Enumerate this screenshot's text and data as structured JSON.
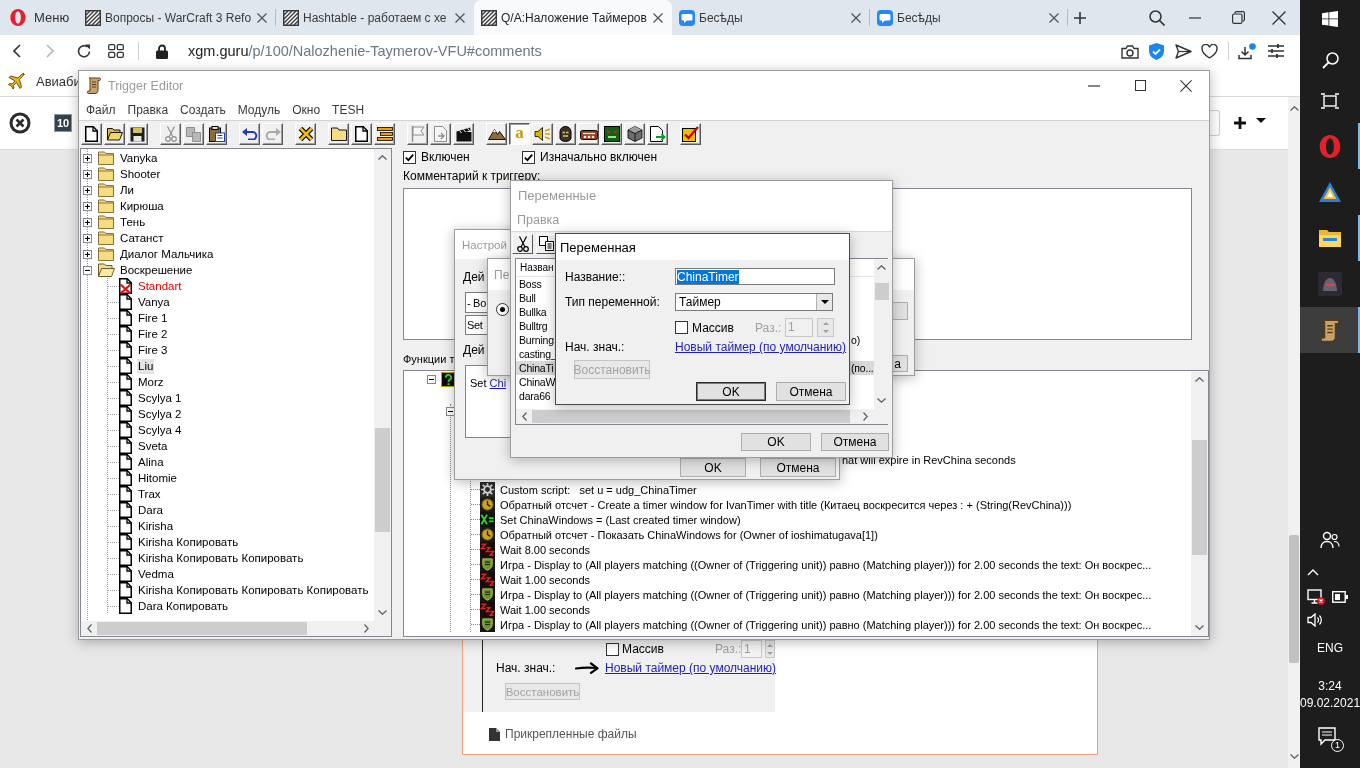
{
  "browser": {
    "menu": {
      "label": "Меню"
    },
    "tabs": [
      {
        "kind": "site",
        "title": "Вопросы - WarCraft 3 Refo",
        "selected": false
      },
      {
        "kind": "site",
        "title": "Hashtable - работаем с хе",
        "selected": false
      },
      {
        "kind": "site",
        "title": "Q/A:Наложение Таймеров",
        "selected": true
      },
      {
        "kind": "chat",
        "title": "Бесѣды",
        "selected": false
      },
      {
        "kind": "chat",
        "title": "Бесѣды",
        "selected": false
      }
    ],
    "nav": [
      {
        "kind": "back",
        "disabled": false
      },
      {
        "kind": "forward",
        "disabled": true
      },
      {
        "kind": "reload",
        "disabled": false
      }
    ],
    "address": {
      "host": "xgm.guru",
      "path": "/p/100/Nalozhenie-Taymerov-VFU#comments"
    },
    "bookmarks": [
      {
        "label": "Авиаби"
      }
    ]
  },
  "page": {
    "badge": "10",
    "preview": {
      "array": {
        "label": "Массив",
        "checked": false
      },
      "size": {
        "label": "Раз.:",
        "value": "1",
        "disabled": true
      },
      "initial_label": "Нач. знач.:",
      "initial_link": "Новый таймер (по умолчанию)",
      "restore": {
        "label": "Восстановить",
        "disabled": true
      }
    },
    "attachments_label": "Прикрепленные файлы"
  },
  "trigger_editor": {
    "title": "Trigger Editor",
    "menu": [
      "Файл",
      "Правка",
      "Создать",
      "Модуль",
      "Окно",
      "TESH"
    ],
    "toolbar": [
      [
        {
          "kind": "new",
          "disabled": false,
          "pressed": false
        },
        {
          "kind": "open",
          "disabled": false,
          "pressed": false
        },
        {
          "kind": "save",
          "disabled": false,
          "pressed": false
        }
      ],
      [
        {
          "kind": "cut",
          "disabled": true,
          "pressed": false
        },
        {
          "kind": "copy",
          "disabled": true,
          "pressed": false
        },
        {
          "kind": "paste",
          "disabled": false,
          "pressed": false
        }
      ],
      [
        {
          "kind": "undo",
          "disabled": false,
          "pressed": false
        },
        {
          "kind": "redo",
          "disabled": true,
          "pressed": false
        }
      ],
      [
        {
          "kind": "close",
          "disabled": false,
          "pressed": false
        }
      ],
      [
        {
          "kind": "folder",
          "disabled": false,
          "pressed": false
        },
        {
          "kind": "trigger",
          "disabled": false,
          "pressed": false
        },
        {
          "kind": "comment",
          "disabled": false,
          "pressed": false
        }
      ],
      [
        {
          "kind": "flag",
          "disabled": true,
          "pressed": false
        },
        {
          "kind": "doc",
          "disabled": true,
          "pressed": false
        },
        {
          "kind": "clapper",
          "disabled": false,
          "pressed": false
        }
      ],
      [
        {
          "kind": "terrain",
          "disabled": false,
          "pressed": false
        },
        {
          "kind": "text",
          "glyph": "a",
          "disabled": false,
          "pressed": true
        },
        {
          "kind": "sound",
          "disabled": false,
          "pressed": false
        },
        {
          "kind": "mask",
          "disabled": false,
          "pressed": false
        },
        {
          "kind": "object",
          "disabled": false,
          "pressed": false
        },
        {
          "kind": "face",
          "disabled": false,
          "pressed": false
        },
        {
          "kind": "box",
          "disabled": false,
          "pressed": false
        },
        {
          "kind": "import",
          "disabled": false,
          "pressed": false
        }
      ],
      [
        {
          "kind": "validate",
          "disabled": false,
          "pressed": false
        }
      ]
    ],
    "tree": [
      {
        "label": "Vanyka",
        "expanded": false,
        "selected": false
      },
      {
        "label": "Shooter",
        "expanded": false,
        "selected": false
      },
      {
        "label": "Ли",
        "expanded": false,
        "selected": false
      },
      {
        "label": "Кирюша",
        "expanded": false,
        "selected": false
      },
      {
        "label": "Тень",
        "expanded": false,
        "selected": false
      },
      {
        "label": "Сатанст",
        "expanded": false,
        "selected": false
      },
      {
        "label": "Диалог Мальчика",
        "expanded": false,
        "selected": false
      },
      {
        "label": "Воскрешение",
        "expanded": true,
        "selected": false,
        "children": [
          {
            "label": "Standart",
            "enabled": false,
            "selected": false
          },
          {
            "label": "Vanya",
            "enabled": true,
            "selected": false
          },
          {
            "label": "Fire 1",
            "enabled": true,
            "selected": false
          },
          {
            "label": "Fire 2",
            "enabled": true,
            "selected": false
          },
          {
            "label": "Fire 3",
            "enabled": true,
            "selected": false
          },
          {
            "label": "Liu",
            "enabled": true,
            "selected": true
          },
          {
            "label": "Morz",
            "enabled": true,
            "selected": false
          },
          {
            "label": "Scylya 1",
            "enabled": true,
            "selected": false
          },
          {
            "label": "Scylya 2",
            "enabled": true,
            "selected": false
          },
          {
            "label": "Scylya 4",
            "enabled": true,
            "selected": false
          },
          {
            "label": "Sveta",
            "enabled": true,
            "selected": false
          },
          {
            "label": "Alina",
            "enabled": true,
            "selected": false
          },
          {
            "label": "Hitomie",
            "enabled": true,
            "selected": false
          },
          {
            "label": "Trax",
            "enabled": true,
            "selected": false
          },
          {
            "label": "Dara",
            "enabled": true,
            "selected": false
          },
          {
            "label": "Kirisha",
            "enabled": true,
            "selected": false
          },
          {
            "label": "Kirisha Копировать",
            "enabled": true,
            "selected": false
          },
          {
            "label": "Kirisha Копировать Копировать",
            "enabled": true,
            "selected": false
          },
          {
            "label": "Vedma",
            "enabled": true,
            "selected": false
          },
          {
            "label": "Kirisha Копировать Копировать Копировать",
            "enabled": true,
            "selected": false
          },
          {
            "label": "Dara Копировать",
            "enabled": true,
            "selected": false
          }
        ]
      }
    ],
    "enabled": {
      "label": "Включен",
      "checked": true
    },
    "initially_on": {
      "label": "Изначально включен",
      "checked": true
    },
    "comment_label": "Комментарий к триггеру:",
    "functions_label": "Функции т",
    "functions": [
      {
        "kind": "question",
        "expanded": true,
        "children": [
          {
            "expanded": true,
            "children": [
              {
                "kind": "partial",
                "text": "hat will expire in RevChina seconds"
              },
              {
                "kind": "script",
                "text": "Custom script:   set u = udg_ChinaTimer"
              },
              {
                "kind": "countdown",
                "text": "Обратный отсчет - Create a timer window for IvanTimer with title (Китаец воскресится через : + (String(RevChina)))"
              },
              {
                "kind": "set",
                "text": "Set ChinaWindows = (Last created timer window)"
              },
              {
                "kind": "countdown",
                "text": "Обратный отсчет - Показать ChinaWindows for (Owner of ioshimatugava[1])"
              },
              {
                "kind": "wait",
                "text": "Wait 8.00 seconds"
              },
              {
                "kind": "game",
                "text": "Игра - Display to (All players matching ((Owner of (Triggering unit)) равно (Matching player))) for 2.00 seconds the text: Он воскрес..."
              },
              {
                "kind": "wait",
                "text": "Wait 1.00 seconds"
              },
              {
                "kind": "game",
                "text": "Игра - Display to (All players matching ((Owner of (Triggering unit)) равно (Matching player))) for 2.00 seconds the text: Он воскрес..."
              },
              {
                "kind": "wait",
                "text": "Wait 1.00 seconds"
              },
              {
                "kind": "game",
                "text": "Игра - Display to (All players matching ((Owner of (Triggering unit)) равно (Matching player))) for 2.00 seconds the text: Он воскрес..."
              }
            ]
          }
        ]
      }
    ]
  },
  "action_dialog": {
    "title": "Настрой",
    "label_1": "Дей",
    "combo_1": "- Во",
    "combo_2": "Set",
    "label_2": "Дей",
    "preview": {
      "text": "Set",
      "link": "Chi"
    },
    "buttons": [
      "OK",
      "Отмена"
    ]
  },
  "pick_dialog": {
    "title": "Пе",
    "radio": {
      "selected": true
    },
    "button_text": "a"
  },
  "variables_window": {
    "title": "Переменные",
    "menu": [
      "Правка"
    ],
    "column_1": "Назван",
    "rows": [
      {
        "name": "Boss",
        "selected": false
      },
      {
        "name": "Bull",
        "selected": false
      },
      {
        "name": "Bullka",
        "selected": false
      },
      {
        "name": "Bulltrg",
        "selected": false
      },
      {
        "name": "Burning",
        "column_3": "о)",
        "selected": false
      },
      {
        "name": "casting_",
        "selected": false
      },
      {
        "name": "ChinaTi",
        "column_3": "(по...",
        "selected": true
      },
      {
        "name": "ChinaW",
        "selected": false
      },
      {
        "name": "dara66",
        "selected": false
      }
    ],
    "buttons": [
      "OK",
      "Отмена"
    ]
  },
  "variable_dialog": {
    "title": "Переменная",
    "name_label": "Название::",
    "name_value": "ChinaTimer",
    "name_selected": true,
    "type_label": "Тип переменной:",
    "type_value": "Таймер",
    "array": {
      "label": "Массив",
      "checked": false
    },
    "size": {
      "label": "Раз.:",
      "value": "1",
      "disabled": true
    },
    "initial_label": "Нач. знач.:",
    "initial_link": "Новый таймер (по умолчанию)",
    "restore": {
      "label": "Восстановить",
      "disabled": true
    },
    "buttons": [
      {
        "label": "OK",
        "default": true
      },
      {
        "label": "Отмена",
        "default": false
      }
    ]
  },
  "taskbar": {
    "apps": [
      {
        "kind": "browser",
        "running": true,
        "selected": false
      },
      {
        "kind": "triangle",
        "running": false,
        "selected": false
      },
      {
        "kind": "folder",
        "running": true,
        "selected": false
      },
      {
        "kind": "game",
        "running": false,
        "selected": false
      },
      {
        "kind": "editor",
        "running": true,
        "selected": true
      }
    ],
    "tray": {
      "language": "ENG",
      "time": "3:24",
      "date": "09.02.2021",
      "notifications": "1"
    }
  }
}
